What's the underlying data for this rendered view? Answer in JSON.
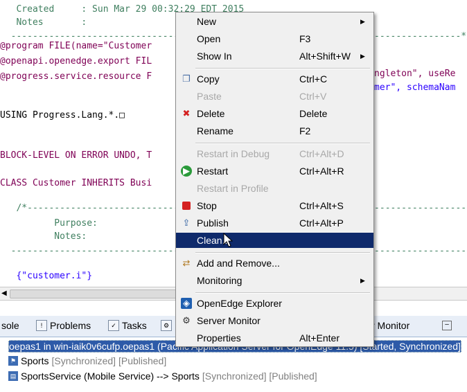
{
  "editor": {
    "lines": [
      {
        "text": "   Created     : Sun Mar 29 00:32:29 EDT 2015",
        "cls": "cmt"
      },
      {
        "text": "   Notes       :",
        "cls": "cmt"
      },
      {
        "text": "  -----------------------------------------------------------------------------------*/",
        "cls": "cmt"
      },
      {
        "text": "",
        "cls": "plain"
      },
      {
        "text": "@program FILE(name=\"Customer",
        "cls": "kw"
      },
      {
        "text": "@openapi.openedge.export FIL",
        "cls": "kw"
      },
      {
        "text": "@progress.service.resource F",
        "cls": "kw"
      },
      {
        "text": "",
        "cls": "plain"
      },
      {
        "text": "USING Progress.Lang.*.□",
        "cls": "plain"
      },
      {
        "text": "",
        "cls": "plain"
      },
      {
        "text": "",
        "cls": "plain"
      },
      {
        "text": "BLOCK-LEVEL ON ERROR UNDO, T",
        "cls": "kw"
      },
      {
        "text": "",
        "cls": "plain"
      },
      {
        "text": "CLASS Customer INHERITS Busi",
        "cls": "kw"
      },
      {
        "text": "",
        "cls": "plain"
      },
      {
        "text": "   /*------------------------------------------------------------------------------------------",
        "cls": "cmt"
      },
      {
        "text": "          Purpose:",
        "cls": "cmt"
      },
      {
        "text": "          Notes:",
        "cls": "cmt"
      },
      {
        "text": "  --------------------------------------------------------------------------------------------",
        "cls": "cmt"
      },
      {
        "text": "",
        "cls": "plain"
      },
      {
        "text": "   {\"customer.i\"}",
        "cls": "str"
      }
    ],
    "right_fragments": [
      {
        "text": "ngleton\", useRe",
        "row": 5
      },
      {
        "text": "mer\", schemaNam",
        "row": 6
      }
    ]
  },
  "tabs": [
    {
      "label": "sole",
      "icon": "console-icon"
    },
    {
      "label": "Problems",
      "icon": "problems-icon"
    },
    {
      "label": "Tasks",
      "icon": "tasks-icon"
    },
    {
      "label": "",
      "icon": "servers-icon"
    },
    {
      "label": "r Monitor",
      "icon": ""
    }
  ],
  "servers": [
    {
      "label": "oepas1 in win-iaik0v6cufp.oepas1 (Pacific Application Server for OpenEdge 11.5)  [Started, Synchronized]",
      "selected": true
    },
    {
      "label": "Sports",
      "deco": "[Synchronized] [Published]"
    },
    {
      "label": "SportsService (Mobile Service) --> Sports",
      "deco": "[Synchronized] [Published]"
    }
  ],
  "menu": {
    "items": [
      {
        "label": "New",
        "accel": "",
        "submenu": true,
        "icon": "",
        "disabled": false
      },
      {
        "label": "Open",
        "accel": "F3",
        "submenu": false,
        "icon": "",
        "disabled": false
      },
      {
        "label": "Show In",
        "accel": "Alt+Shift+W",
        "submenu": true,
        "icon": "",
        "disabled": false
      },
      {
        "sep": true
      },
      {
        "label": "Copy",
        "accel": "Ctrl+C",
        "submenu": false,
        "icon": "copy-icon",
        "disabled": false
      },
      {
        "label": "Paste",
        "accel": "Ctrl+V",
        "submenu": false,
        "icon": "",
        "disabled": true
      },
      {
        "label": "Delete",
        "accel": "Delete",
        "submenu": false,
        "icon": "delete-icon",
        "disabled": false
      },
      {
        "label": "Rename",
        "accel": "F2",
        "submenu": false,
        "icon": "",
        "disabled": false
      },
      {
        "sep": true
      },
      {
        "label": "Restart in Debug",
        "accel": "Ctrl+Alt+D",
        "submenu": false,
        "icon": "",
        "disabled": true
      },
      {
        "label": "Restart",
        "accel": "Ctrl+Alt+R",
        "submenu": false,
        "icon": "restart-icon",
        "disabled": false
      },
      {
        "label": "Restart in Profile",
        "accel": "",
        "submenu": false,
        "icon": "",
        "disabled": true
      },
      {
        "label": "Stop",
        "accel": "Ctrl+Alt+S",
        "submenu": false,
        "icon": "stop-icon",
        "disabled": false
      },
      {
        "label": "Publish",
        "accel": "Ctrl+Alt+P",
        "submenu": false,
        "icon": "publish-icon",
        "disabled": false
      },
      {
        "label": "Clean...",
        "accel": "",
        "submenu": false,
        "icon": "",
        "disabled": false,
        "highlight": true
      },
      {
        "sep": true
      },
      {
        "label": "Add and Remove...",
        "accel": "",
        "submenu": false,
        "icon": "add-remove-icon",
        "disabled": false
      },
      {
        "label": "Monitoring",
        "accel": "",
        "submenu": true,
        "icon": "",
        "disabled": false
      },
      {
        "sep": true
      },
      {
        "label": "OpenEdge Explorer",
        "accel": "",
        "submenu": false,
        "icon": "openedge-explorer-icon",
        "disabled": false
      },
      {
        "label": "Server Monitor",
        "accel": "",
        "submenu": false,
        "icon": "server-monitor-icon",
        "disabled": false
      },
      {
        "label": "Properties",
        "accel": "Alt+Enter",
        "submenu": false,
        "icon": "",
        "disabled": false
      }
    ]
  }
}
